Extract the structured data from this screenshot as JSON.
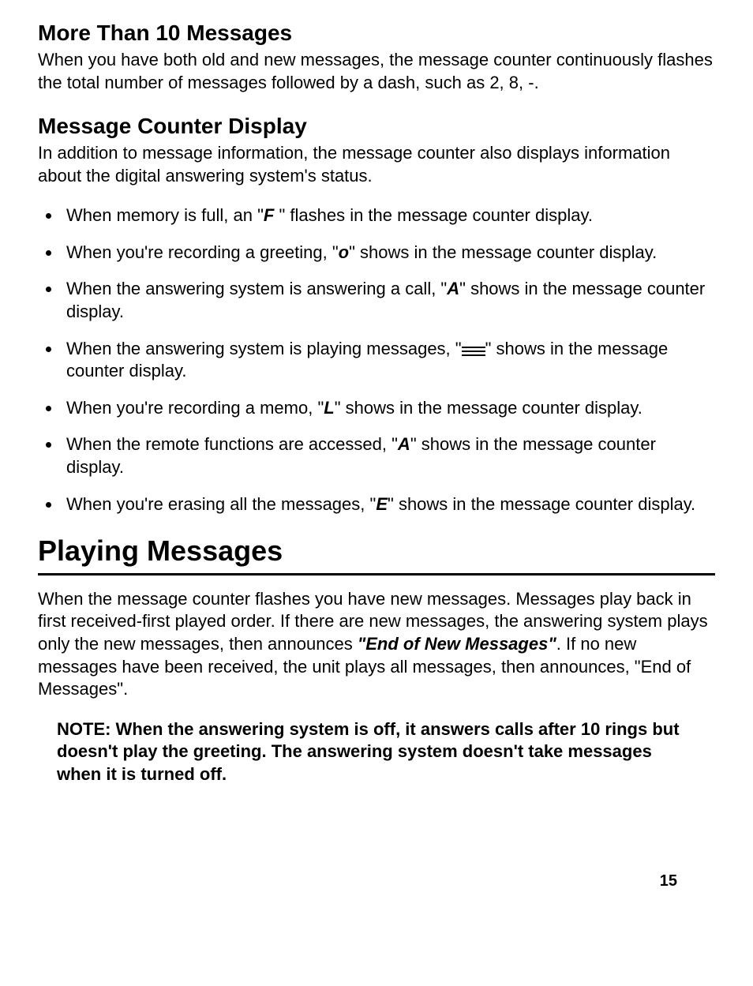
{
  "section1": {
    "heading": "More Than 10 Messages",
    "body": "When you have both old and new messages, the message counter continuously flashes the total number of messages followed by a dash, such as 2, 8, -."
  },
  "section2": {
    "heading": "Message Counter Display",
    "body": "In addition to message information, the message counter also displays information about the digital answering system's status.",
    "items": {
      "i0a": "When memory is full, an \"",
      "i0b": "F",
      "i0c": " \" flashes in the message counter display.",
      "i1a": "When you're recording a greeting, \"",
      "i1b": "o",
      "i1c": "\" shows in the message counter display.",
      "i2a": "When the answering system is answering a call, \"",
      "i2b": "A",
      "i2c": "\" shows  in the message counter display.",
      "i3a": "When the answering system is playing messages, \"",
      "i3c": "\" shows in the message counter display.",
      "i4a": "When you're recording a memo, \"",
      "i4b": "L",
      "i4c": "\" shows in the message counter display.",
      "i5a": "When the remote functions are accessed, \"",
      "i5b": "A",
      "i5c": "\" shows in the message counter display.",
      "i6a": "When you're erasing all the messages, \"",
      "i6b": "E",
      "i6c": "\" shows in the message counter display."
    }
  },
  "section3": {
    "heading": "Playing Messages",
    "body_a": "When the message counter flashes you have new messages. Messages play back in first received-first played order. If there are new messages, the answering system plays only the new messages, then announces ",
    "body_b": "\"End of New Messages\"",
    "body_c": ". If no new messages have been received, the unit plays all messages, then announces, \"End of Messages\".",
    "note": "NOTE: When the answering system  is off, it answers calls after 10 rings but doesn't play the greeting. The answering system doesn't take messages when it is turned off."
  },
  "page_number": "15"
}
